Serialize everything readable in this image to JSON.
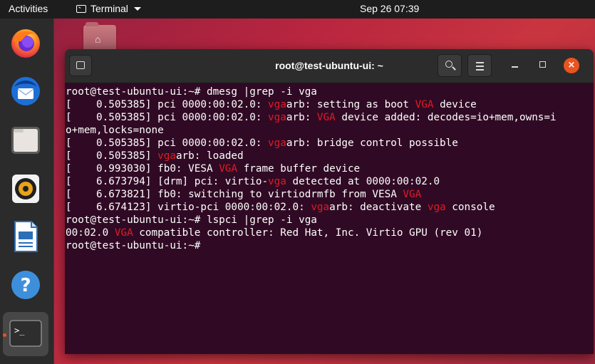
{
  "topbar": {
    "activities": "Activities",
    "app_menu": "Terminal",
    "clock": "Sep 26  07:39"
  },
  "dock": {
    "items": [
      {
        "name": "firefox",
        "icon": "firefox-icon"
      },
      {
        "name": "thunderbird",
        "icon": "thunderbird-icon"
      },
      {
        "name": "files",
        "icon": "files-icon"
      },
      {
        "name": "rhythmbox",
        "icon": "rhythmbox-icon"
      },
      {
        "name": "writer",
        "icon": "libreoffice-writer-icon"
      },
      {
        "name": "help",
        "icon": "help-icon"
      },
      {
        "name": "terminal",
        "icon": "terminal-icon",
        "running": true
      }
    ],
    "terminal_prompt_glyph": ">_",
    "help_glyph": "?"
  },
  "window": {
    "title": "root@test-ubuntu-ui: ~",
    "close_glyph": "×"
  },
  "terminal": {
    "lines": [
      [
        {
          "t": "root@test-ubuntu-ui:~# dmesg |grep -i vga"
        }
      ],
      [
        {
          "t": "[    0.505385] pci 0000:00:02.0: "
        },
        {
          "t": "vga",
          "h": true
        },
        {
          "t": "arb: setting as boot "
        },
        {
          "t": "VGA",
          "h": true
        },
        {
          "t": " device"
        }
      ],
      [
        {
          "t": "[    0.505385] pci 0000:00:02.0: "
        },
        {
          "t": "vga",
          "h": true
        },
        {
          "t": "arb: "
        },
        {
          "t": "VGA",
          "h": true
        },
        {
          "t": " device added: decodes=io+mem,owns=i"
        }
      ],
      [
        {
          "t": "o+mem,locks=none"
        }
      ],
      [
        {
          "t": "[    0.505385] pci 0000:00:02.0: "
        },
        {
          "t": "vga",
          "h": true
        },
        {
          "t": "arb: bridge control possible"
        }
      ],
      [
        {
          "t": "[    0.505385] "
        },
        {
          "t": "vga",
          "h": true
        },
        {
          "t": "arb: loaded"
        }
      ],
      [
        {
          "t": "[    0.993030] fb0: VESA "
        },
        {
          "t": "VGA",
          "h": true
        },
        {
          "t": " frame buffer device"
        }
      ],
      [
        {
          "t": "[    6.673794] [drm] pci: virtio-"
        },
        {
          "t": "vga",
          "h": true
        },
        {
          "t": " detected at 0000:00:02.0"
        }
      ],
      [
        {
          "t": "[    6.673821] fb0: switching to virtiodrmfb from VESA "
        },
        {
          "t": "VGA",
          "h": true
        }
      ],
      [
        {
          "t": "[    6.674123] virtio-pci 0000:00:02.0: "
        },
        {
          "t": "vga",
          "h": true
        },
        {
          "t": "arb: deactivate "
        },
        {
          "t": "vga",
          "h": true
        },
        {
          "t": " console"
        }
      ],
      [
        {
          "t": "root@test-ubuntu-ui:~# lspci |grep -i vga"
        }
      ],
      [
        {
          "t": "00:02.0 "
        },
        {
          "t": "VGA",
          "h": true
        },
        {
          "t": " compatible controller: Red Hat, Inc. Virtio GPU (rev 01)"
        }
      ],
      [
        {
          "t": "root@test-ubuntu-ui:~#"
        }
      ]
    ]
  },
  "colors": {
    "terminal_bg": "#300a24",
    "highlight": "#e01b24",
    "close_button": "#e95420"
  }
}
